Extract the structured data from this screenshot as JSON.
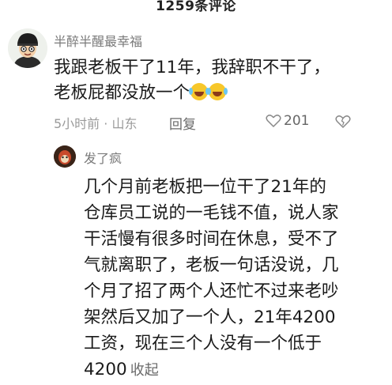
{
  "header": {
    "title": "1259条评论"
  },
  "comment": {
    "username": "半醉半醒最幸福",
    "text_lines": [
      "我跟老板干了11年，我辞职不干了，",
      "老板屁都没放一个"
    ],
    "emojis": [
      "laughing-tears",
      "laughing-tears"
    ],
    "time_location": "5小时前 · 山东",
    "reply_label": "回复",
    "like_count": "201"
  },
  "reply": {
    "username": "发了疯",
    "text_lines": [
      "几个月前老板把一位干了21年的",
      "仓库员工说的一毛钱不值，说人家",
      "干活慢有很多时间在休息，受不了",
      "气就离职了，老板一句话没说，几",
      "个月了招了两个人还忙不过来老吵",
      "架然后又加了一个人，21年4200",
      "工资，现在三个人没有一个低于",
      "4200"
    ],
    "collapse_label": "收起"
  },
  "colors": {
    "text": "#1a1a1a",
    "meta": "#9a9a9a",
    "username": "#7a7a7a"
  }
}
